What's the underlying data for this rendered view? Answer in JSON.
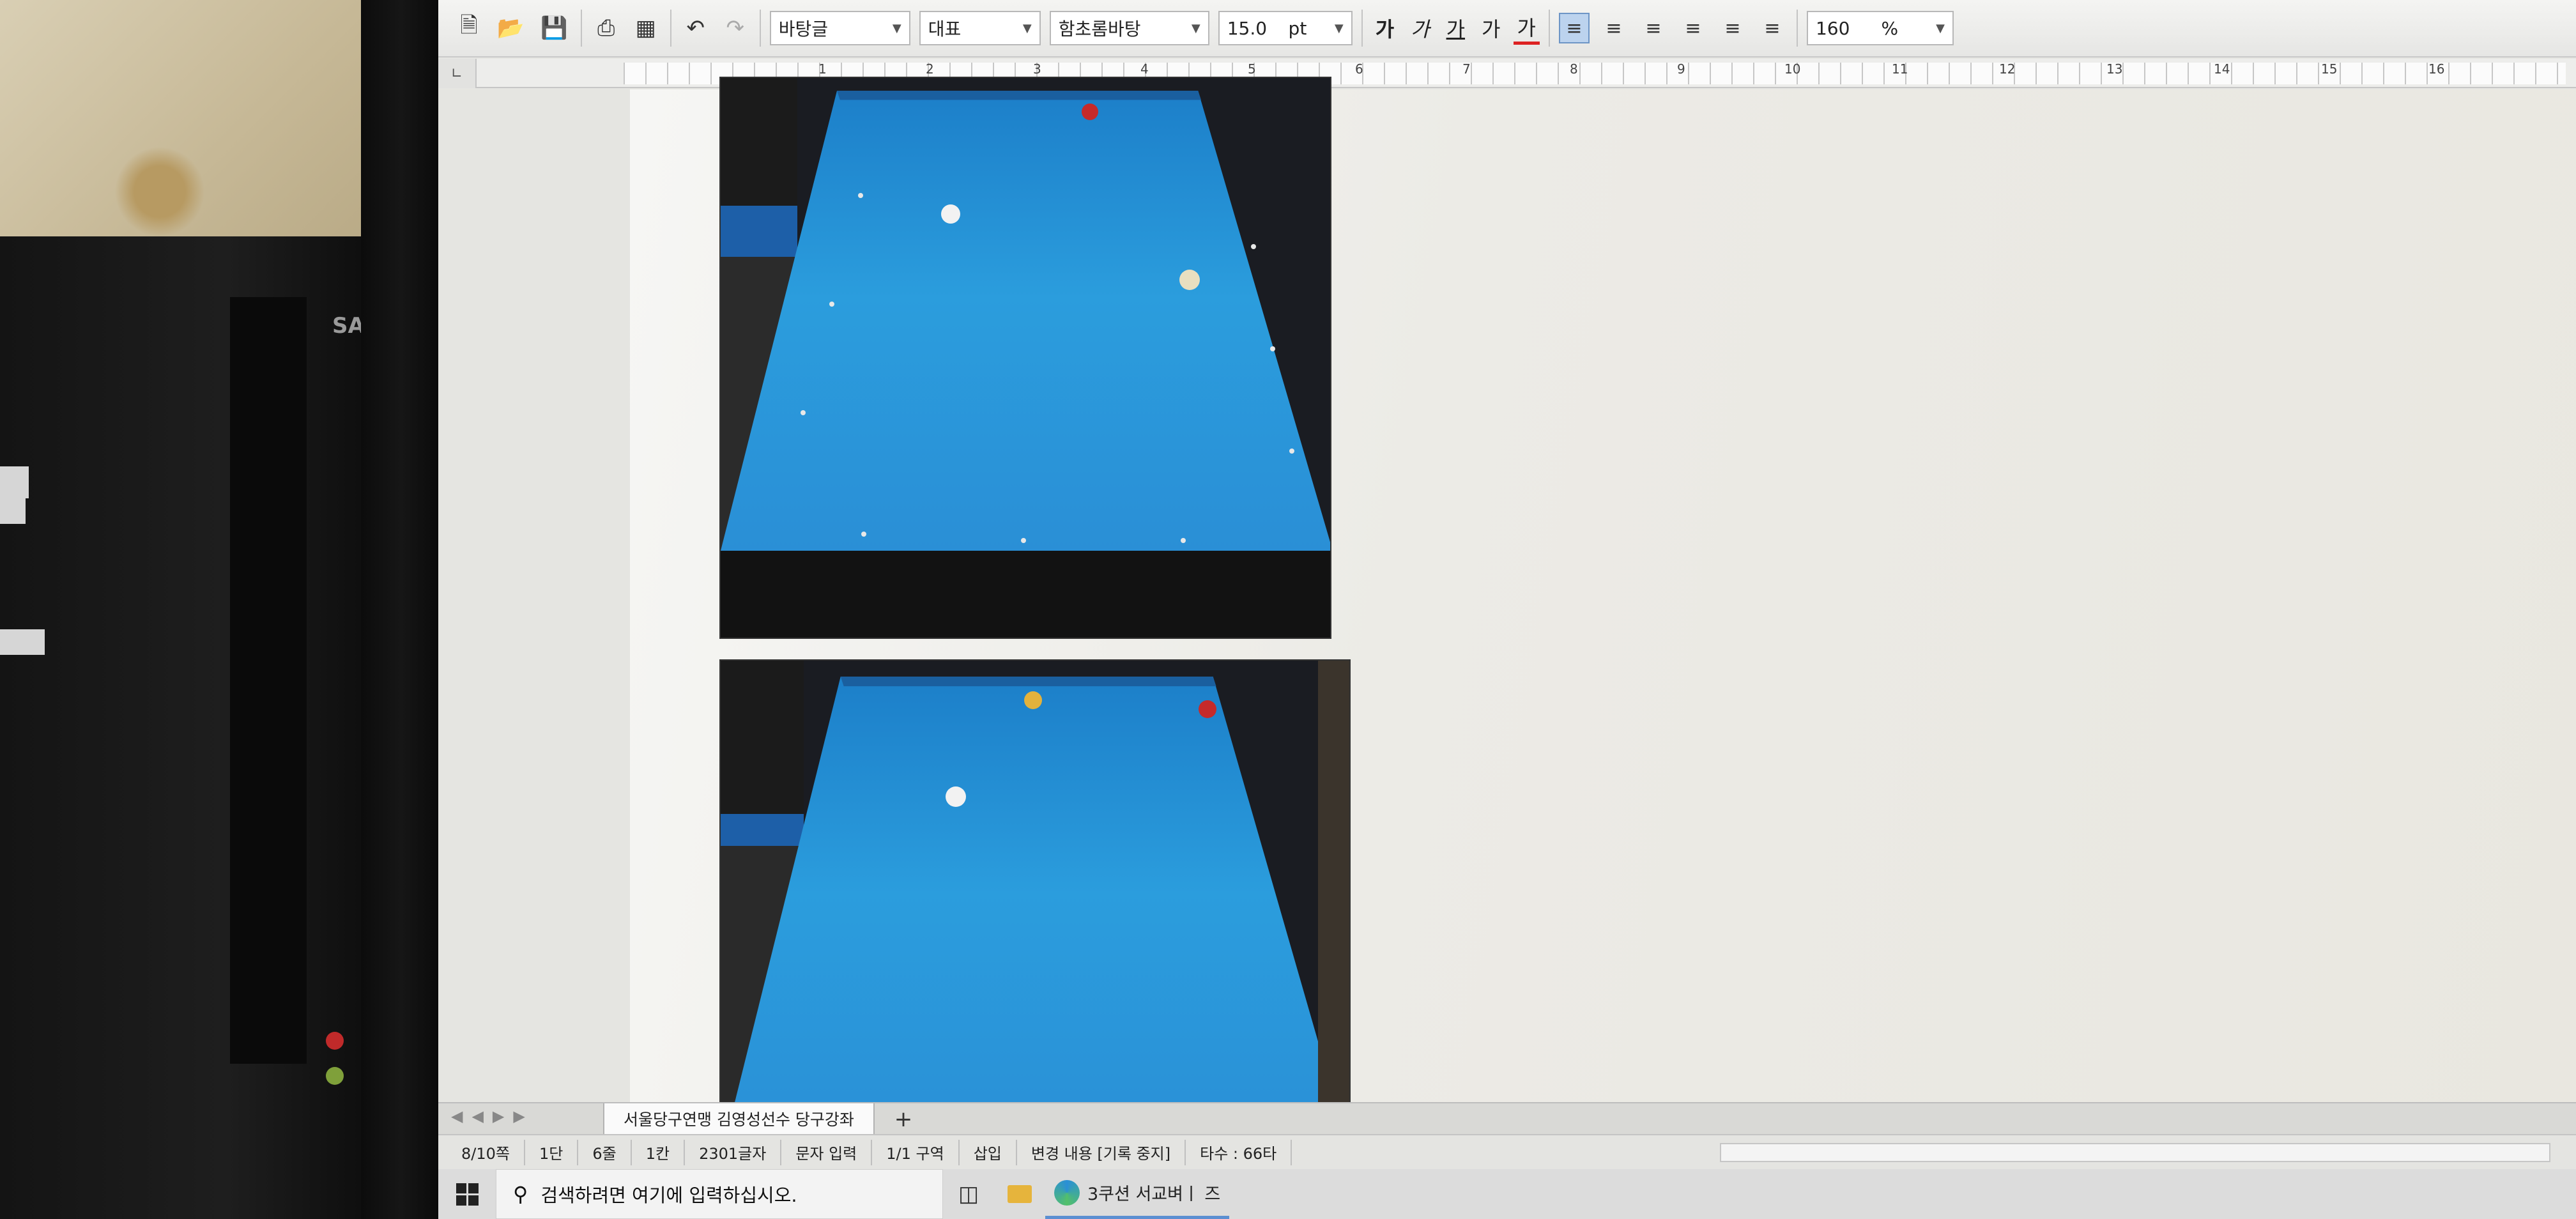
{
  "toolbar": {
    "style_combo": "바탕글",
    "shape_combo": "대표",
    "font_combo": "함초롬바탕",
    "font_size": "15.0",
    "font_unit": "pt",
    "bold": "가",
    "italic": "가",
    "underline": "가",
    "strike": "가",
    "font_color": "가",
    "zoom_value": "160",
    "zoom_unit": "%"
  },
  "ruler": {
    "numbers": [
      "1",
      "2",
      "3",
      "4",
      "5",
      "6",
      "7",
      "8",
      "9",
      "10",
      "11",
      "12",
      "13",
      "14",
      "15",
      "16"
    ]
  },
  "pc": {
    "brand": "SAN"
  },
  "tabs": {
    "sheet_name": "서울당구연맹 김영성선수 당구강좌",
    "add": "+"
  },
  "status": {
    "page": "8/10쪽",
    "column": "1단",
    "line": "6줄",
    "char": "1칸",
    "count": "2301글자",
    "mode": "문자 입력",
    "section": "1/1 구역",
    "insert": "삽입",
    "track": "변경 내용 [기록 중지]",
    "typing": "타수 : 66타"
  },
  "taskbar": {
    "search_placeholder": "검색하려면 여기에 입력하십시오.",
    "app_label": "3쿠션 서교벼ㅣ 즈"
  },
  "colors": {
    "felt": "#2b9ddd",
    "cushion": "#1a5f9f",
    "red_ball": "#c62a2a",
    "yellow_ball": "#e3b23c",
    "white_ball": "#f2f2f2"
  }
}
